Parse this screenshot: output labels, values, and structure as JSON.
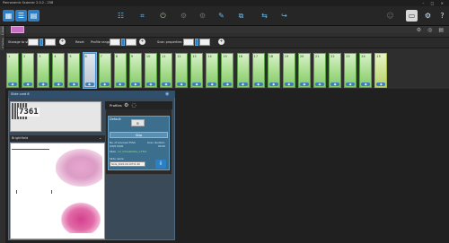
{
  "window": {
    "title": "Pannoramic Scanner 2.0.2 - 258",
    "controls": "– □ ×"
  },
  "toolbar": {
    "icons": [
      "view-grid-icon",
      "view-list-icon",
      "view-tiles-icon",
      "adjust-icon",
      "microscope-icon",
      "power-icon",
      "settings-disabled-icon",
      "gear-disabled-icon",
      "edit-icon",
      "network-icon",
      "export-icon",
      "transfer-icon",
      "user-icon",
      "monitor-icon",
      "gear-icon",
      "help-icon"
    ],
    "glyphs": [
      "▦",
      "☰",
      "▤",
      "☷",
      "⌗",
      "⏻",
      "⚙",
      "⚙",
      "✎",
      "⧉",
      "⇆",
      "↪",
      "☺",
      "▭",
      "⚙",
      "?"
    ]
  },
  "tabs": {
    "top_vertical": "1 Scan",
    "mid_vertical": "2 Setup"
  },
  "settings_row": {
    "magazine_label": "Storage to skip",
    "magazine_from": "1",
    "magazine_to": "1",
    "reset_label": "Reset",
    "profile_label": "Profile range",
    "profile_from": "1",
    "profile_to": "1",
    "scan_label": "Scan properties range",
    "scan_from": "1",
    "scan_to": "1",
    "add_glyph": "+"
  },
  "row1_icons": [
    "⚙",
    "◎",
    "▤"
  ],
  "slots": [
    "1",
    "2",
    "3",
    "4",
    "5",
    "6",
    "7",
    "8",
    "9",
    "10",
    "11",
    "12",
    "13",
    "14",
    "15",
    "16",
    "17",
    "18",
    "19",
    "20",
    "21",
    "22",
    "23",
    "24",
    "25"
  ],
  "selected_slot": "6",
  "slide_card": {
    "title": "Slide card 6",
    "label_text": "7361",
    "channel": "Brightfield",
    "chevron": "⌄"
  },
  "profiles": {
    "title": "Profiles",
    "default_label": "Default",
    "chip_label": "B",
    "button_label": "Skip",
    "scanned_fovs_label": "No. of scanned FOVs",
    "scan_duration_label": "Scan duration",
    "scanned_fovs_value": "0/0/0 0/0/0",
    "scan_duration_value": "00:00",
    "slide_label": "Slide",
    "slide_link": "(1) (VirtualSlide_1-F5X)",
    "slide_name_label": "Slide name",
    "slide_name_value": "Slide_2020-09-10T11:46"
  },
  "colors": {
    "accent": "#2a7fc6",
    "slot_green": "#a7dc8d",
    "purple_tab": "#c86fc6",
    "profile_box": "#3c6f8e"
  }
}
